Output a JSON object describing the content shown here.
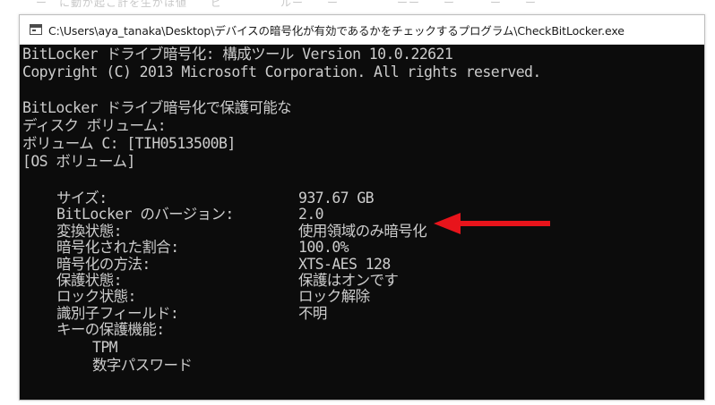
{
  "window": {
    "title": "C:\\Users\\aya_tanaka\\Desktop\\デバイスの暗号化が有効であるかをチェックするプログラム\\CheckBitLocker.exe"
  },
  "console": {
    "header": [
      "BitLocker ドライブ暗号化: 構成ツール Version 10.0.22621",
      "Copyright (C) 2013 Microsoft Corporation. All rights reserved."
    ],
    "intro": [
      "BitLocker ドライブ暗号化で保護可能な",
      "ディスク ボリューム:",
      "ボリューム C: [TIH0513500B]",
      "[OS ボリューム]"
    ],
    "properties": [
      {
        "label": "サイズ:",
        "value": "937.67 GB"
      },
      {
        "label": "BitLocker のバージョン:",
        "value": "2.0"
      },
      {
        "label": "変換状態:",
        "value": "使用領域のみ暗号化"
      },
      {
        "label": "暗号化された割合:",
        "value": "100.0%"
      },
      {
        "label": "暗号化の方法:",
        "value": "XTS-AES 128"
      },
      {
        "label": "保護状態:",
        "value": "保護はオンです"
      },
      {
        "label": "ロック状態:",
        "value": "ロック解除"
      },
      {
        "label": "識別子フィールド:",
        "value": "不明"
      },
      {
        "label": "キーの保護機能:",
        "value": ""
      }
    ],
    "key_protectors": [
      "TPM",
      "数字パスワード"
    ]
  },
  "annotation": {
    "arrow_color": "#e8141b",
    "points_to": "変換状態"
  },
  "colors": {
    "console_bg": "#0c0c0c",
    "console_text": "#cccccc"
  }
}
